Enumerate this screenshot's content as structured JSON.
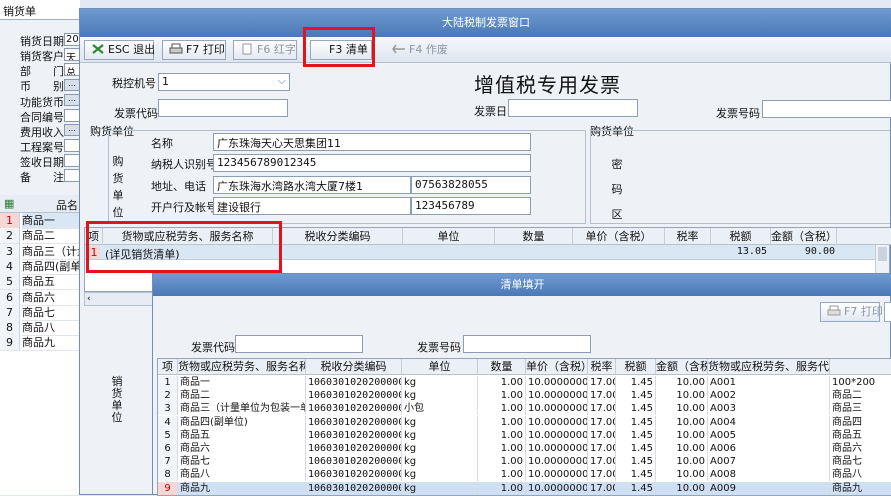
{
  "background_form": {
    "title": "销货单",
    "fields": [
      {
        "label": "销货日期",
        "value": "20"
      },
      {
        "label": "销货客户",
        "value": "天"
      },
      {
        "label": "部　　门",
        "value": "总"
      },
      {
        "label": "币　　别",
        "value": "…"
      },
      {
        "label": "功能货币",
        "value": "…"
      },
      {
        "label": "合同编号",
        "value": ""
      },
      {
        "label": "费用收入",
        "value": "…"
      },
      {
        "label": "工程案号",
        "value": ""
      },
      {
        "label": "签收日期",
        "value": ""
      },
      {
        "label": "备　　注",
        "value": ""
      }
    ],
    "grid_header": "品名",
    "rows": [
      {
        "num": "1",
        "name": "商品一"
      },
      {
        "num": "2",
        "name": "商品二"
      },
      {
        "num": "3",
        "name": "商品三（计量"
      },
      {
        "num": "4",
        "name": "商品四(副单"
      },
      {
        "num": "5",
        "name": "商品五"
      },
      {
        "num": "6",
        "name": "商品六"
      },
      {
        "num": "7",
        "name": "商品七"
      },
      {
        "num": "8",
        "name": "商品八"
      },
      {
        "num": "9",
        "name": "商品九"
      }
    ]
  },
  "invoice_window": {
    "title": "大陆税制发票窗口",
    "toolbar": {
      "exit": "ESC 退出",
      "print": "F7 打印",
      "red": "F6 红字",
      "list": "F3 清单",
      "void": "F4 作废"
    },
    "tax_machine_label": "税控机号",
    "tax_machine_value": "1",
    "invoice_title": "增值税专用发票",
    "invoice_code_label": "发票代码",
    "invoice_date_label": "发票日",
    "invoice_number_label": "发票号码",
    "buyer_group_label": "购货单位",
    "buyer_side": [
      "购",
      "货",
      "单",
      "位"
    ],
    "buyer_fields": {
      "name_label": "名称",
      "name_value": "广东珠海天心天思集团11",
      "taxid_label": "纳税人识别号",
      "taxid_value": "123456789012345",
      "address_label": "地址、电话",
      "address_value": "广东珠海水湾路水湾大厦7楼1",
      "phone_value": "07563828055",
      "bank_label": "开户行及帐号",
      "bank_value": "建设银行",
      "account_value": "123456789"
    },
    "password_group_label": "购货单位",
    "password_side": [
      "密",
      "码",
      "区"
    ],
    "grid_headers": [
      "项",
      "货物或应税劳务、服务名称",
      "税收分类编码",
      "单位",
      "数量",
      "单价（含税）",
      "税率",
      "税额",
      "金额（含税）"
    ],
    "grid_row": {
      "num": "1",
      "name": "(详见销货清单)",
      "tax": "13.05",
      "amount": "90.00"
    }
  },
  "list_dialog": {
    "title": "清单填开",
    "print_button": "F7 打印",
    "invoice_code_label": "发票代码",
    "invoice_number_label": "发票号码",
    "seller_side": [
      "销",
      "货",
      "单",
      "位"
    ],
    "headers": [
      "项",
      "货物或应税劳务、服务名称",
      "税收分类编码",
      "单位",
      "数量",
      "单价（含税）",
      "税率",
      "税额",
      "金额（含税）",
      "货物或应税劳务、服务代号",
      ""
    ],
    "rows": [
      {
        "num": "1",
        "name": "商品一",
        "code": "1060301020200000000",
        "unit": "kg",
        "qty": "1.00",
        "price": "10.00000000",
        "rate": "17.00",
        "tax": "1.45",
        "amount": "10.00",
        "item_code": "A001",
        "extra": "100*200"
      },
      {
        "num": "2",
        "name": "商品二",
        "code": "1060301020200000000",
        "unit": "kg",
        "qty": "1.00",
        "price": "10.00000000",
        "rate": "17.00",
        "tax": "1.45",
        "amount": "10.00",
        "item_code": "A002",
        "extra": "商品二"
      },
      {
        "num": "3",
        "name": "商品三（计量单位为包装一单",
        "code": "1060301020200000000",
        "unit": "小包",
        "qty": "1.00",
        "price": "10.00000000",
        "rate": "17.00",
        "tax": "1.45",
        "amount": "10.00",
        "item_code": "A003",
        "extra": "商品三"
      },
      {
        "num": "4",
        "name": "商品四(副单位)",
        "code": "1060301020200000000",
        "unit": "kg",
        "qty": "1.00",
        "price": "10.00000000",
        "rate": "17.00",
        "tax": "1.45",
        "amount": "10.00",
        "item_code": "A004",
        "extra": "商品四"
      },
      {
        "num": "5",
        "name": "商品五",
        "code": "1060301020200000000",
        "unit": "kg",
        "qty": "1.00",
        "price": "10.00000000",
        "rate": "17.00",
        "tax": "1.45",
        "amount": "10.00",
        "item_code": "A005",
        "extra": "商品五"
      },
      {
        "num": "6",
        "name": "商品六",
        "code": "1060301020200000000",
        "unit": "kg",
        "qty": "1.00",
        "price": "10.00000000",
        "rate": "17.00",
        "tax": "1.45",
        "amount": "10.00",
        "item_code": "A006",
        "extra": "商品六"
      },
      {
        "num": "7",
        "name": "商品七",
        "code": "1060301020200000000",
        "unit": "kg",
        "qty": "1.00",
        "price": "10.00000000",
        "rate": "17.00",
        "tax": "1.45",
        "amount": "10.00",
        "item_code": "A007",
        "extra": "商品七"
      },
      {
        "num": "8",
        "name": "商品八",
        "code": "1060301020200000000",
        "unit": "kg",
        "qty": "1.00",
        "price": "10.00000000",
        "rate": "17.00",
        "tax": "1.45",
        "amount": "10.00",
        "item_code": "A008",
        "extra": "商品八"
      },
      {
        "num": "9",
        "name": "商品九",
        "code": "1060301020200000000",
        "unit": "kg",
        "qty": "1.00",
        "price": "10.00000000",
        "rate": "17.00",
        "tax": "1.45",
        "amount": "10.00",
        "item_code": "A009",
        "extra": "商品九"
      }
    ]
  },
  "colors": {
    "title_bar": "#4a78b5",
    "highlight": "#e0141b",
    "selected_row": "#cfe0f5"
  }
}
